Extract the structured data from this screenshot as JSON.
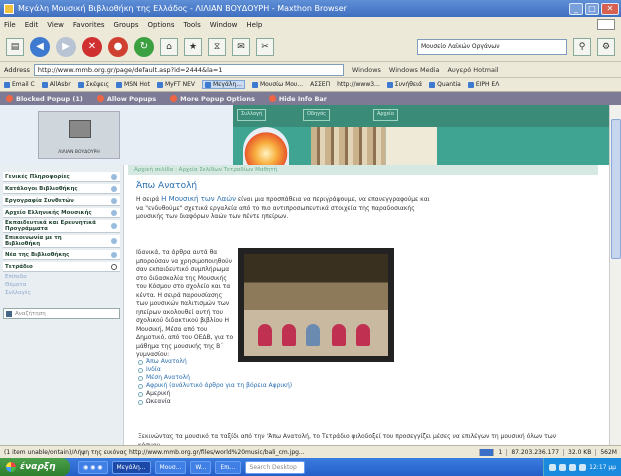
{
  "window": {
    "title": "Μεγάλη Μουσική Βιβλιοθήκη της Ελλάδος - ΛΙΛΙΑΝ ΒΟΥΔΟΥΡΗ - Maxthon Browser"
  },
  "menu": [
    "File",
    "Edit",
    "View",
    "Favorites",
    "Groups",
    "Options",
    "Tools",
    "Window",
    "Help"
  ],
  "search": {
    "value": "Μουσείο Λαϊκών Οργάνων"
  },
  "address": {
    "label": "Address",
    "url": "http://www.mmb.org.gr/page/default.asp?id=2444&la=1",
    "links": [
      "Windows",
      "Windows Media",
      "Αυγερό Hotmail"
    ]
  },
  "bookmarks": [
    "Email C",
    "AllAsbr",
    "Σκέψεις",
    "MSN Hot",
    "MyFT NEV",
    "Μεγάλη...",
    "Μουσίω Μου...",
    "ΑΣΣΕΠ",
    "http://www3...",
    "Συνήθειά",
    "Quantia",
    "ΕΙΡΗ ΕΛ"
  ],
  "popup_bar": [
    "Blocked Popup (1)",
    "Allow Popups",
    "More Popup Options",
    "Hide Info Bar"
  ],
  "logo": {
    "caption": "ΛΙΛΙΑΝ ΒΟΥΔΟΥΡΗ"
  },
  "banner": {
    "tabs": [
      "Συλλογή",
      "Οδηγός",
      "Αρχείο"
    ]
  },
  "sidebar": {
    "items": [
      "Γενικές Πληροφορίες",
      "Κατάλογοι Βιβλιοθήκης",
      "Εργογραφία Συνθετών",
      "Αρχείο Ελληνικής Μουσικής",
      "Εκπαιδευτικά και Ερευνητικά Προγράμματα",
      "Επικοινωνία με τη Βιβλιοθήκη",
      "Νέα της Βιβλιοθήκης",
      "Τετράδιο"
    ],
    "subitems": [
      "Επίπεδο",
      "Θέματα",
      "Συλλογές"
    ],
    "search_label": "Αναζήτηση"
  },
  "content": {
    "breadcrumb": "Αρχική σελίδα : Αρχεία Σελίδων Τετραδίων Μαθητή",
    "title": "Άπω Ανατολή",
    "intro_prefix": "Η σειρά ",
    "intro_highlight": "Η Μουσική των Λαών",
    "intro_rest": " είναι μια προσπάθεια να περιγράψουμε, να επανεγγραφούμε και να \"ενδυθούμε\" σχετικά εργαλεία από το πιο αντιπροσωπευτικά στοιχεία της παραδοσιακής μουσικής των διαφόρων λαών των πέντε ηπείρων.",
    "side_text": "Ιδανικά, τα άρθρα αυτά θα μπορούσαν να χρησιμοποιηθούν σαν εκπαιδευτικό συμπλήρωμα στο διδασκαλία της Μουσικής του Κόσμου στο σχολείο και τα κέντα. Η σειρά παρουσίασης των μουσικών παλιτισμών των ηπείρων ακολουθεί αυτή του σχολικού διδακτικού βιβλίου Η Μουσική, Μέσα από του Δημοτικό, από του ΟΕΔΒ, για το μάθημα της μουσικής της Β΄ γυμνασίου:",
    "list": [
      "Άπω Ανατολή",
      "Ινδία",
      "Μέση Ανατολή",
      "Αφρική (ανάλυτικό άρθρο για τη βόρεια Αφρική)",
      "Αμερική",
      "Ωκεανία"
    ],
    "footer": "Ξεκινώντας τα μουσικό τα ταξίδι από την 'Άπω Ανατολή, το Τετράδιο φιλοδοξεί του προσεγγίζει μέσες να επιλέγων τη μουσική όλων των κόσμου."
  },
  "status": {
    "left": "(1 item unable/ontain)/Λήψη της εικόνας http://www.mmb.org.gr/files/world%20music/bali_cm.jpg...",
    "page_count": "1",
    "ip": "87.203.236.177",
    "speed": "32.0 KB",
    "mem": "562M"
  },
  "taskbar": {
    "start": "έναρξη",
    "items": [
      "Μεγάλη...",
      "Μουσ...",
      "W...",
      "Επι..."
    ],
    "search": "Search Desktop",
    "clock": "12:17 μμ"
  },
  "colors": {
    "accent": "#2b6fb0",
    "banner": "#3fa592",
    "titlebar": "#3f6fc0",
    "popupbar": "#7d7a96"
  }
}
